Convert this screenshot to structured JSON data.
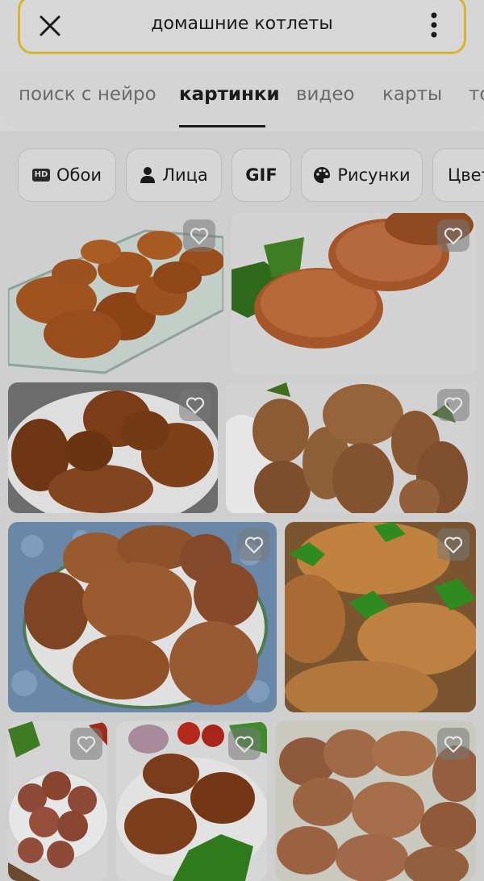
{
  "search": {
    "query": "домашние котлеты"
  },
  "tabs": [
    {
      "label": "поиск с нейро"
    },
    {
      "label": "картинки",
      "active": true
    },
    {
      "label": "видео"
    },
    {
      "label": "карты"
    },
    {
      "label": "то"
    }
  ],
  "chips": [
    {
      "label": "Обои",
      "icon": "hd-icon",
      "badge": "HD"
    },
    {
      "label": "Лица",
      "icon": "person-icon"
    },
    {
      "label": "GIF"
    },
    {
      "label": "Рисунки",
      "icon": "palette-icon"
    },
    {
      "label": "Цвет"
    }
  ],
  "images": [
    {
      "subject": "cutlets in glass baking dish",
      "favorite_icon": "heart-icon"
    },
    {
      "subject": "cutlets with parsley",
      "favorite_icon": "heart-icon"
    },
    {
      "subject": "cutlets on white plate",
      "favorite_icon": "heart-icon"
    },
    {
      "subject": "stacked cutlets",
      "favorite_icon": "heart-icon"
    },
    {
      "subject": "cutlets on blue patterned plate",
      "favorite_icon": "heart-icon"
    },
    {
      "subject": "cutlets with parsley close-up",
      "favorite_icon": "heart-icon"
    },
    {
      "subject": "cutlets with vegetables",
      "favorite_icon": "heart-icon"
    },
    {
      "subject": "cutlets with tomatoes and onion",
      "favorite_icon": "heart-icon"
    },
    {
      "subject": "pile of cutlets",
      "favorite_icon": "heart-icon"
    }
  ],
  "colors": {
    "search_border": "#d9b52f",
    "dim_overlay": "#cfcfcf"
  }
}
